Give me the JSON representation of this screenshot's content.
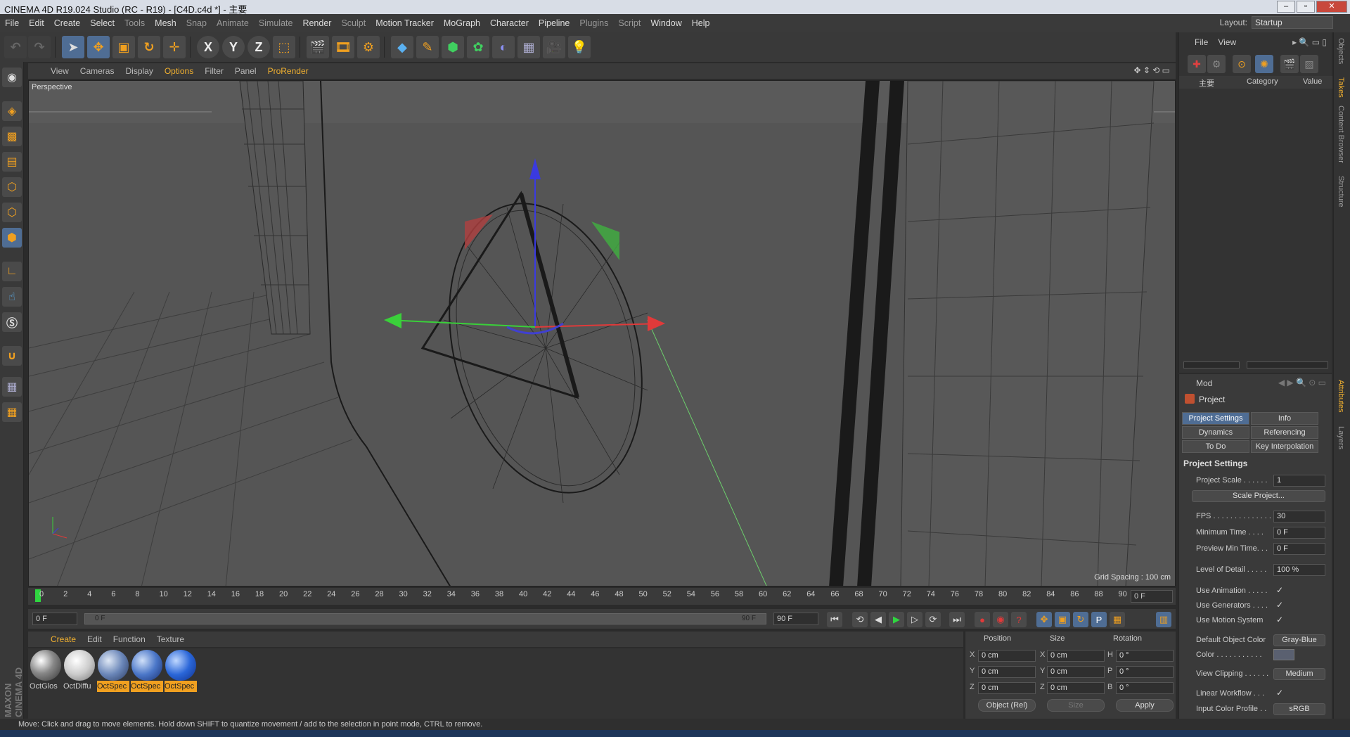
{
  "window": {
    "title": "CINEMA 4D R19.024 Studio (RC - R19) - [C4D.c4d *] - 主要"
  },
  "menubar": {
    "items": [
      {
        "label": "File",
        "dim": false
      },
      {
        "label": "Edit",
        "dim": false
      },
      {
        "label": "Create",
        "dim": false
      },
      {
        "label": "Select",
        "dim": false
      },
      {
        "label": "Tools",
        "dim": true
      },
      {
        "label": "Mesh",
        "dim": false
      },
      {
        "label": "Snap",
        "dim": true
      },
      {
        "label": "Animate",
        "dim": true
      },
      {
        "label": "Simulate",
        "dim": true
      },
      {
        "label": "Render",
        "dim": false
      },
      {
        "label": "Sculpt",
        "dim": true
      },
      {
        "label": "Motion Tracker",
        "dim": false
      },
      {
        "label": "MoGraph",
        "dim": false
      },
      {
        "label": "Character",
        "dim": false
      },
      {
        "label": "Pipeline",
        "dim": false
      },
      {
        "label": "Plugins",
        "dim": true
      },
      {
        "label": "Script",
        "dim": true
      },
      {
        "label": "Window",
        "dim": false
      },
      {
        "label": "Help",
        "dim": false
      }
    ],
    "layout_label": "Layout:",
    "layout_value": "Startup"
  },
  "toolbar": {
    "x_label": "X",
    "y_label": "Y",
    "z_label": "Z"
  },
  "viewport": {
    "menu": [
      {
        "label": "View",
        "hl": false
      },
      {
        "label": "Cameras",
        "hl": false
      },
      {
        "label": "Display",
        "hl": false
      },
      {
        "label": "Options",
        "hl": true
      },
      {
        "label": "Filter",
        "hl": false
      },
      {
        "label": "Panel",
        "hl": false
      },
      {
        "label": "ProRender",
        "hl": true
      }
    ],
    "camera_label": "Perspective",
    "grid_spacing": "Grid Spacing : 100 cm"
  },
  "timeline": {
    "ticks": [
      "0",
      "2",
      "4",
      "6",
      "8",
      "10",
      "12",
      "14",
      "16",
      "18",
      "20",
      "22",
      "24",
      "26",
      "28",
      "30",
      "32",
      "34",
      "36",
      "38",
      "40",
      "42",
      "44",
      "46",
      "48",
      "50",
      "52",
      "54",
      "56",
      "58",
      "60",
      "62",
      "64",
      "66",
      "68",
      "70",
      "72",
      "74",
      "76",
      "78",
      "80",
      "82",
      "84",
      "86",
      "88",
      "90"
    ],
    "current_frame": "0 F",
    "start_field": "0 F",
    "range_start": "0 F",
    "range_end": "90 F",
    "end_field": "90 F"
  },
  "materials": {
    "menu": [
      {
        "label": "Create",
        "hl": true
      },
      {
        "label": "Edit",
        "hl": false
      },
      {
        "label": "Function",
        "hl": false
      },
      {
        "label": "Texture",
        "hl": false
      }
    ],
    "items": [
      {
        "label": "OctGlos",
        "selected": false
      },
      {
        "label": "OctDiffu",
        "selected": false
      },
      {
        "label": "OctSpec",
        "selected": true
      },
      {
        "label": "OctSpec",
        "selected": true
      },
      {
        "label": "OctSpec",
        "selected": true
      }
    ]
  },
  "coordinates": {
    "headers": {
      "position": "Position",
      "size": "Size",
      "rotation": "Rotation"
    },
    "rows": [
      {
        "axis": "X",
        "pos": "0 cm",
        "saxis": "X",
        "size": "0 cm",
        "raxis": "H",
        "rot": "0 °"
      },
      {
        "axis": "Y",
        "pos": "0 cm",
        "saxis": "Y",
        "size": "0 cm",
        "raxis": "P",
        "rot": "0 °"
      },
      {
        "axis": "Z",
        "pos": "0 cm",
        "saxis": "Z",
        "size": "0 cm",
        "raxis": "B",
        "rot": "0 °"
      }
    ],
    "mode": "Object (Rel)",
    "size_mode": "Size",
    "apply": "Apply"
  },
  "status": {
    "text": "Move: Click and drag to move elements. Hold down SHIFT to quantize movement / add to the selection in point mode, CTRL to remove."
  },
  "objects": {
    "menu": [
      "File",
      "View"
    ],
    "header": {
      "name": "主要",
      "category": "Category",
      "value": "Value"
    }
  },
  "attributes": {
    "mode": "Mod",
    "title": "Project",
    "tabs": [
      {
        "label": "Project Settings",
        "active": true
      },
      {
        "label": "Info",
        "active": false
      },
      {
        "label": "Dynamics",
        "active": false
      },
      {
        "label": "Referencing",
        "active": false
      },
      {
        "label": "To Do",
        "active": false
      },
      {
        "label": "Key Interpolation",
        "active": false
      }
    ],
    "section": "Project Settings",
    "project_scale": {
      "label": "Project Scale . . . . . .",
      "value": "1"
    },
    "scale_button": "Scale Project...",
    "fps": {
      "label": "FPS . . . . . . . . . . . . . .",
      "value": "30"
    },
    "min_time": {
      "label": "Minimum Time . . . .",
      "value": "0 F"
    },
    "preview_min": {
      "label": "Preview Min Time. . .",
      "value": "0 F"
    },
    "lod": {
      "label": "Level of Detail . . . . .",
      "value": "100 %"
    },
    "use_animation": {
      "label": "Use Animation . . . . .",
      "mark": "✓"
    },
    "use_generators": {
      "label": "Use Generators . . . .",
      "mark": "✓"
    },
    "use_motion": {
      "label": "Use Motion System",
      "mark": "✓"
    },
    "default_color": {
      "label": "Default Object Color",
      "value": "Gray-Blue"
    },
    "color": {
      "label": "Color . . . . . . . . . . ."
    },
    "view_clipping": {
      "label": "View Clipping . . . . . .",
      "value": "Medium"
    },
    "linear_workflow": {
      "label": "Linear Workflow . . .",
      "mark": "✓"
    },
    "input_profile": {
      "label": "Input Color Profile . .",
      "value": "sRGB"
    }
  },
  "sidetabs": [
    {
      "label": "Objects",
      "active": false
    },
    {
      "label": "Takes",
      "active": true
    },
    {
      "label": "Content Browser",
      "active": false
    },
    {
      "label": "Structure",
      "active": false
    },
    {
      "label": "Attributes",
      "active": true
    },
    {
      "label": "Layers",
      "active": false
    }
  ],
  "brand": "MAXON CINEMA 4D"
}
